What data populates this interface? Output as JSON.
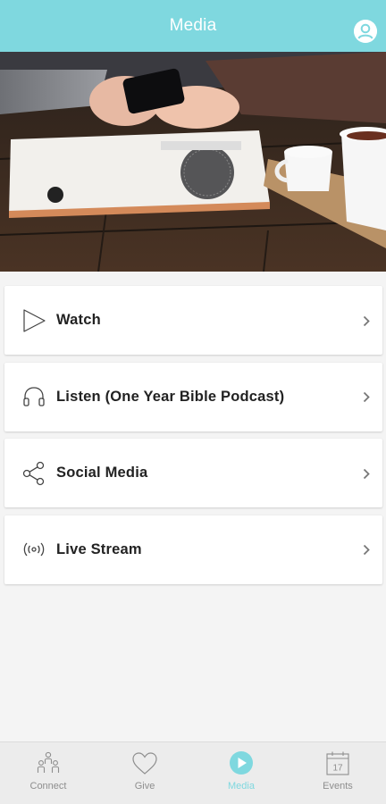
{
  "header": {
    "title": "Media",
    "profile_icon": "profile-icon"
  },
  "hero": {
    "image": "hands-phone-coffee-photo"
  },
  "menu": {
    "items": [
      {
        "label": "Watch",
        "icon": "play-outline-icon"
      },
      {
        "label": "Listen (One Year Bible Podcast)",
        "icon": "headphones-icon"
      },
      {
        "label": "Social Media",
        "icon": "share-icon"
      },
      {
        "label": "Live Stream",
        "icon": "broadcast-icon"
      }
    ]
  },
  "tabbar": {
    "tabs": [
      {
        "label": "Connect",
        "icon": "people-icon",
        "active": false
      },
      {
        "label": "Give",
        "icon": "heart-icon",
        "active": false
      },
      {
        "label": "Media",
        "icon": "play-circle-icon",
        "active": true
      },
      {
        "label": "Events",
        "icon": "calendar-icon",
        "active": false
      }
    ],
    "calendar_day": "17"
  },
  "colors": {
    "accent": "#7fd8df",
    "tab_inactive": "#8e8e8e",
    "text_dark": "#222222"
  }
}
